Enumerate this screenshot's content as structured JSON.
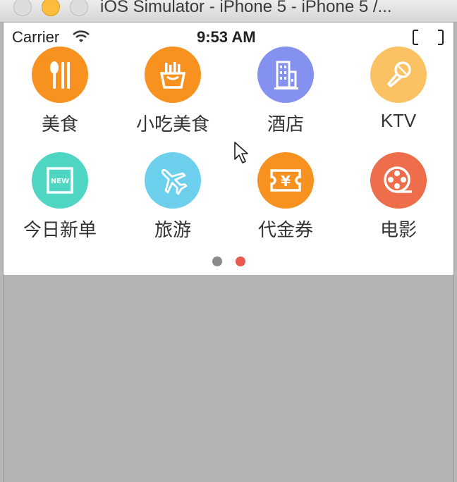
{
  "window": {
    "title": "iOS Simulator - iPhone 5 - iPhone 5 /..."
  },
  "statusbar": {
    "carrier": "Carrier",
    "time": "9:53 AM"
  },
  "categories": [
    {
      "label": "美食",
      "icon": "fork-knife-icon",
      "color": "#f7911f"
    },
    {
      "label": "小吃美食",
      "icon": "fries-icon",
      "color": "#f7911f"
    },
    {
      "label": "酒店",
      "icon": "building-icon",
      "color": "#8591ee"
    },
    {
      "label": "KTV",
      "icon": "microphone-icon",
      "color": "#fbc263"
    },
    {
      "label": "今日新单",
      "icon": "new-badge-icon",
      "color": "#4fd6c2"
    },
    {
      "label": "旅游",
      "icon": "airplane-icon",
      "color": "#6ccfeb"
    },
    {
      "label": "代金券",
      "icon": "coupon-icon",
      "color": "#f7911f"
    },
    {
      "label": "电影",
      "icon": "film-reel-icon",
      "color": "#ee6e4c"
    }
  ],
  "new_badge_text": "NEW",
  "coupon_symbol": "¥",
  "pagination": {
    "pages": 2,
    "current": 2,
    "active_color": "#e85a4f",
    "inactive_color": "#8a8a8a"
  }
}
